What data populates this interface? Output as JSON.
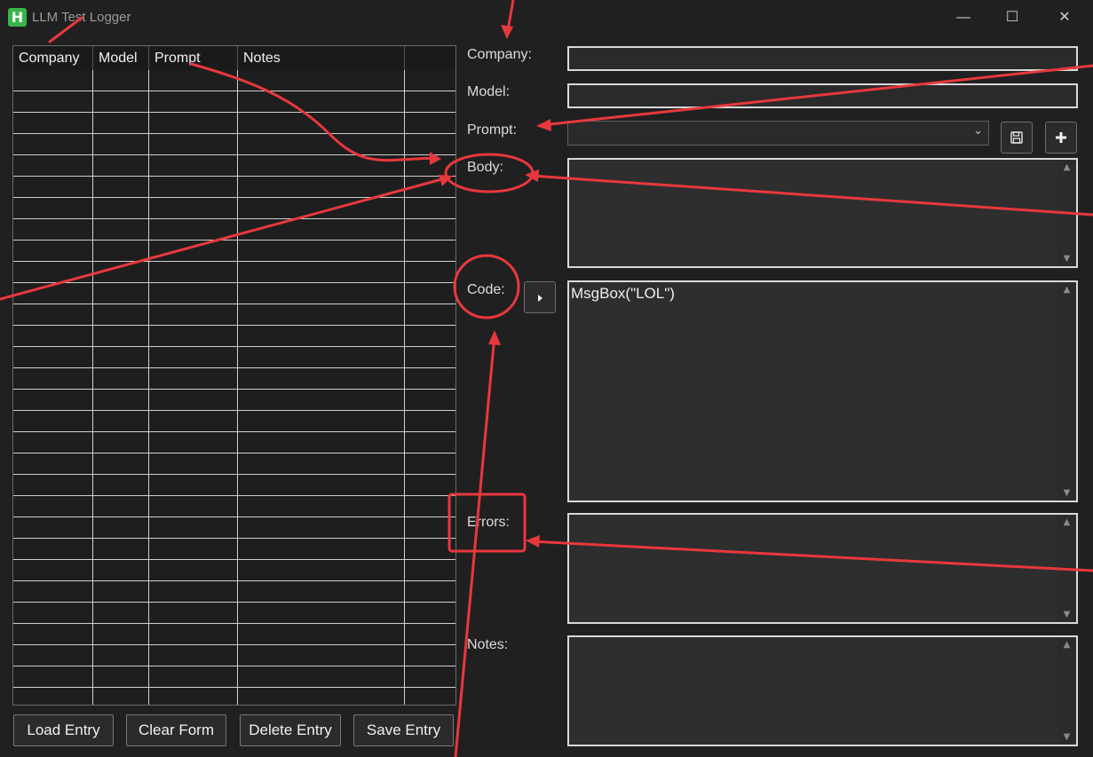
{
  "window": {
    "title": "LLM Test Logger",
    "app_icon_letter": "H",
    "minimize": "—",
    "maximize": "☐",
    "close": "✕"
  },
  "grid": {
    "columns": [
      "Company",
      "Model",
      "Prompt",
      "Notes"
    ],
    "row_count": 29
  },
  "buttons": {
    "load": "Load Entry",
    "clear": "Clear Form",
    "delete": "Delete Entry",
    "save": "Save Entry"
  },
  "form": {
    "company_label": "Company:",
    "model_label": "Model:",
    "prompt_label": "Prompt:",
    "body_label": "Body:",
    "code_label": "Code:",
    "errors_label": "Errors:",
    "notes_label": "Notes:",
    "company_value": "",
    "model_value": "",
    "prompt_selected": "",
    "body_value": "",
    "code_value": "MsgBox(\"LOL\")",
    "errors_value": "",
    "notes_value": ""
  },
  "icons": {
    "save_prompt": "floppy-disk-icon",
    "add_prompt": "plus-icon",
    "run_code": "play-icon",
    "combo_arrow": "chevron-down-icon"
  },
  "colors": {
    "background": "#202020",
    "app_icon": "#39b54a",
    "annotation": "#e8383d"
  }
}
